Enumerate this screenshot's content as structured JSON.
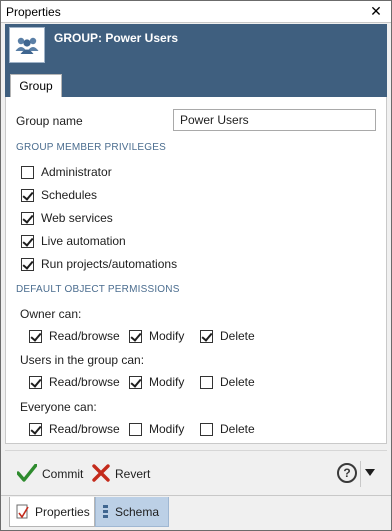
{
  "window": {
    "title": "Properties",
    "close_glyph": "✕"
  },
  "header": {
    "heading": "GROUP: Power Users",
    "icon": "group-users-icon"
  },
  "tabs": [
    {
      "label": "Group",
      "active": true
    }
  ],
  "form": {
    "group_name_label": "Group name",
    "group_name_value": "Power Users"
  },
  "privileges": {
    "heading": "GROUP MEMBER PRIVILEGES",
    "items": [
      {
        "label": "Administrator",
        "checked": false
      },
      {
        "label": "Schedules",
        "checked": true
      },
      {
        "label": "Web services",
        "checked": true
      },
      {
        "label": "Live automation",
        "checked": true
      },
      {
        "label": "Run projects/automations",
        "checked": true
      }
    ]
  },
  "permissions": {
    "heading": "DEFAULT OBJECT PERMISSIONS",
    "groups": [
      {
        "label": "Owner can:",
        "read": {
          "label": "Read/browse",
          "checked": true
        },
        "modify": {
          "label": "Modify",
          "checked": true
        },
        "delete": {
          "label": "Delete",
          "checked": true
        }
      },
      {
        "label": "Users in the group can:",
        "read": {
          "label": "Read/browse",
          "checked": true
        },
        "modify": {
          "label": "Modify",
          "checked": true
        },
        "delete": {
          "label": "Delete",
          "checked": false
        }
      },
      {
        "label": "Everyone can:",
        "read": {
          "label": "Read/browse",
          "checked": true
        },
        "modify": {
          "label": "Modify",
          "checked": false
        },
        "delete": {
          "label": "Delete",
          "checked": false
        }
      }
    ]
  },
  "footer": {
    "commit_label": "Commit",
    "revert_label": "Revert",
    "help_glyph": "?",
    "colors": {
      "commit": "#2e8b2e",
      "revert": "#c42b1c"
    }
  },
  "bottom_tabs": [
    {
      "label": "Properties",
      "active": true
    },
    {
      "label": "Schema",
      "active": false
    }
  ],
  "colors": {
    "header_bg": "#3f5f7f",
    "section_text": "#4b6d8f",
    "schema_tab_bg": "#bcd0e6"
  }
}
